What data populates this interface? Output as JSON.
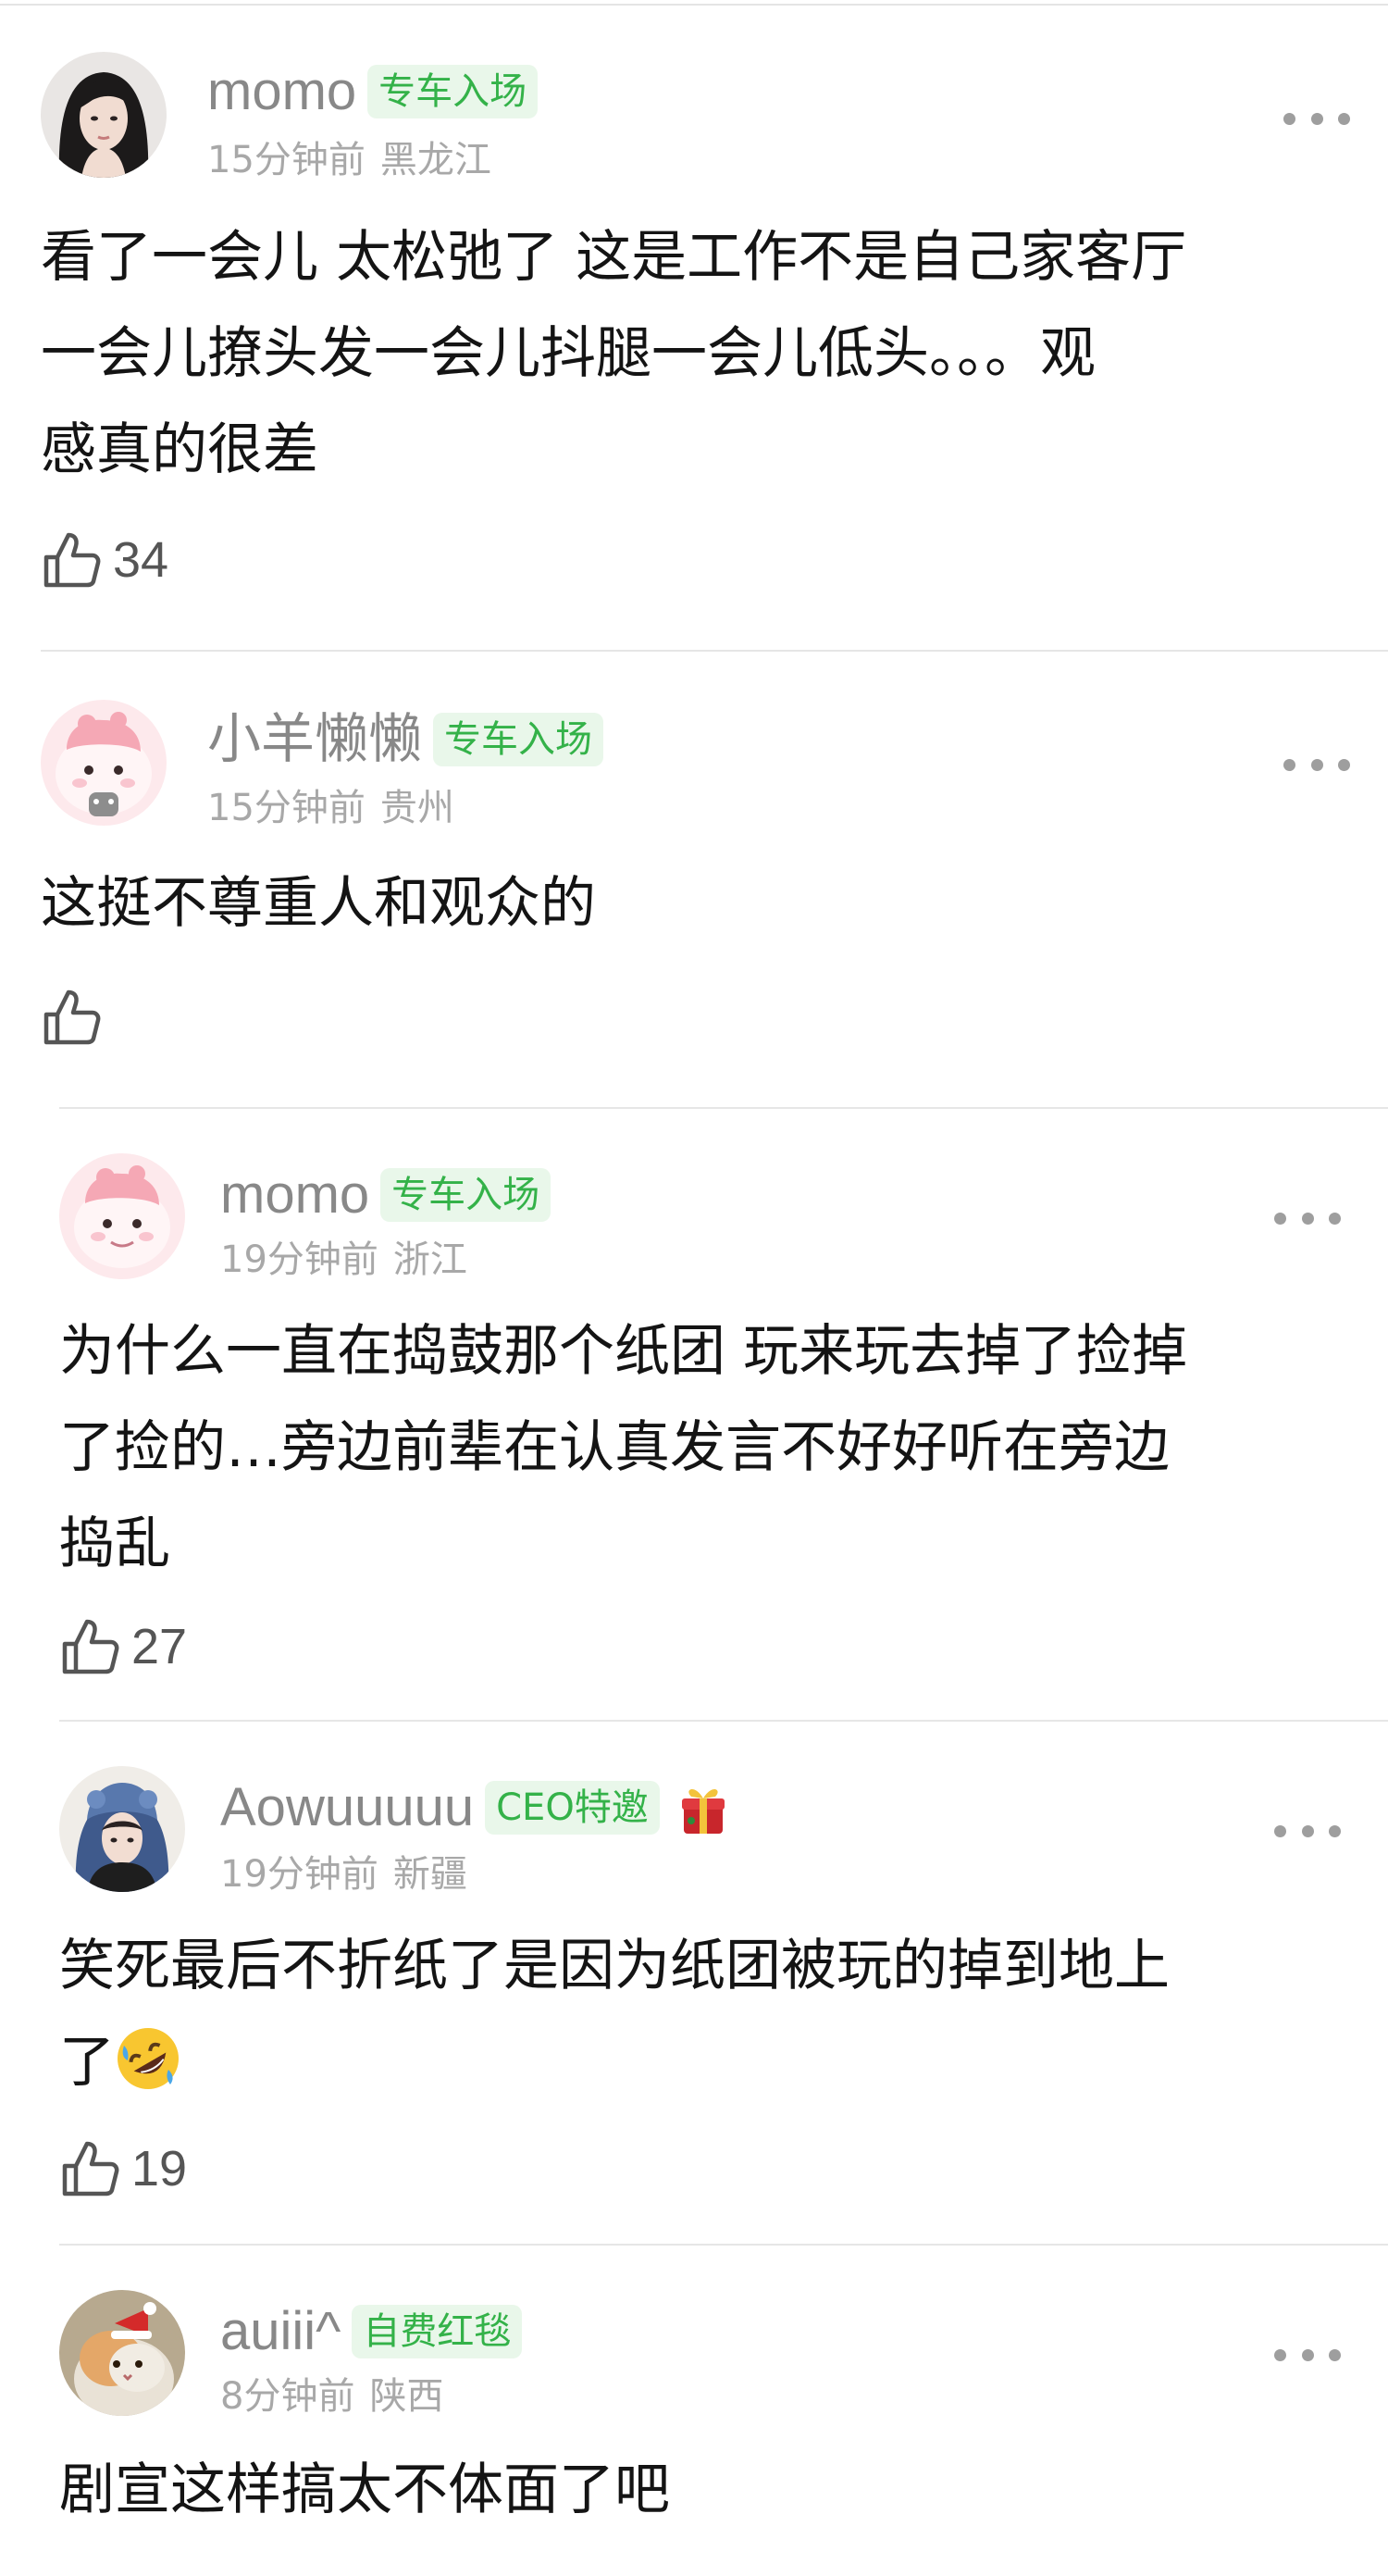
{
  "comments": [
    {
      "username": "momo",
      "badge": "专车入场",
      "time": "15分钟前",
      "location": "黑龙江",
      "lines": [
        "看了一会儿 太松弛了 这是工作不是自己家客厅",
        "一会儿撩头发一会儿抖腿一会儿低头。。。观",
        "感真的很差"
      ],
      "likes": "34",
      "avatar": "woman-dark-hair-avatar"
    },
    {
      "username": "小羊懒懒",
      "badge": "专车入场",
      "time": "15分钟前",
      "location": "贵州",
      "lines": [
        "这挺不尊重人和观众的"
      ],
      "likes": "",
      "avatar": "pink-cartoon-avatar"
    },
    {
      "username": "momo",
      "badge": "专车入场",
      "time": "19分钟前",
      "location": "浙江",
      "lines": [
        "为什么一直在捣鼓那个纸团 玩来玩去掉了捡掉",
        "了捡的…旁边前辈在认真发言不好好听在旁边",
        "捣乱"
      ],
      "likes": "27",
      "avatar": "pink-cartoon-avatar"
    },
    {
      "username": "Aowuuuuu",
      "badge": "CEO特邀",
      "time": "19分钟前",
      "location": "新疆",
      "lines": [
        "笑死最后不折纸了是因为纸团被玩的掉到地上",
        "了"
      ],
      "likes": "19",
      "avatar": "girl-blue-hat-avatar",
      "badge_emoji": "gift-emoji",
      "text_emoji": "rolling-laugh-emoji"
    },
    {
      "username": "auiii^",
      "badge": "自费红毯",
      "time": "8分钟前",
      "location": "陕西",
      "lines": [
        "剧宣这样搞太不体面了吧"
      ],
      "likes": "",
      "avatar": "cat-santa-hat-avatar"
    }
  ],
  "colors": {
    "badge_text": "#34b249",
    "badge_bg": "#e9f7ea",
    "username": "#888888",
    "meta": "#a8a8a8",
    "body_text": "#141414"
  }
}
